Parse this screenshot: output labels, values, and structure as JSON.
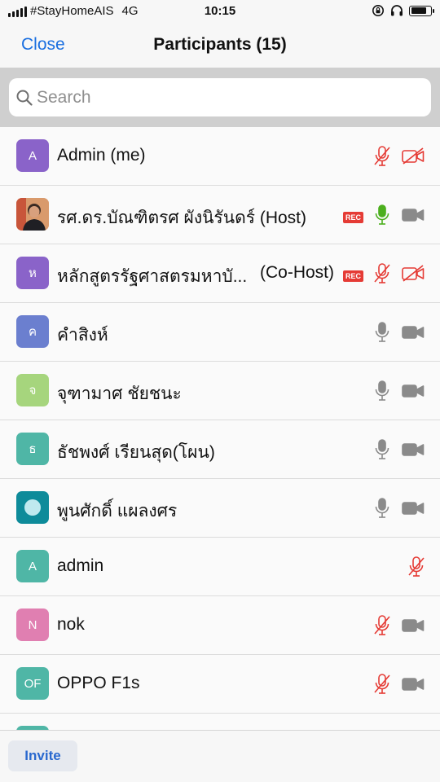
{
  "status_bar": {
    "carrier": "#StayHomeAIS",
    "network": "4G",
    "time": "10:15",
    "battery_level": 0.8
  },
  "nav": {
    "close_label": "Close",
    "title": "Participants (15)"
  },
  "search": {
    "placeholder": "Search"
  },
  "colors": {
    "accent": "#1a6fe0",
    "muted_red": "#e53b35",
    "unmuted_green": "#4caf1e",
    "icon_gray": "#8a8a8a"
  },
  "participants": [
    {
      "initial": "A",
      "avatar_color": "#8a63c9",
      "name": "Admin (me)",
      "role": "",
      "rec": false,
      "mic": "muted",
      "video": "off"
    },
    {
      "initial": "",
      "avatar_color": "photo",
      "name": "รศ.ดร.บัณฑิตรศ ผังนิรันดร์ (Host)",
      "role": "",
      "rec": true,
      "rec_label": "REC",
      "mic": "active",
      "video": "on"
    },
    {
      "initial": "ห",
      "avatar_color": "#8a63c9",
      "name": "หลักสูตรรัฐศาสตรมหาบั...",
      "role": "(Co-Host)",
      "rec": true,
      "rec_label": "REC",
      "mic": "muted",
      "video": "off"
    },
    {
      "initial": "ค",
      "avatar_color": "#6b7fcf",
      "name": "คำสิงห์",
      "role": "",
      "rec": false,
      "mic": "on",
      "video": "on"
    },
    {
      "initial": "จ",
      "avatar_color": "#a6d57d",
      "name": "จุฑามาศ  ชัยชนะ",
      "role": "",
      "rec": false,
      "mic": "on",
      "video": "on"
    },
    {
      "initial": "ธ",
      "avatar_color": "#4fb6a6",
      "name": "ธัชพงศ์ เรียนสุด(โผน)",
      "role": "",
      "rec": false,
      "mic": "on",
      "video": "on"
    },
    {
      "initial": "",
      "avatar_color": "teal-circle",
      "name": "พูนศักดิ์ แผลงศร",
      "role": "",
      "rec": false,
      "mic": "on",
      "video": "on"
    },
    {
      "initial": "A",
      "avatar_color": "#4fb6a6",
      "name": "admin",
      "role": "",
      "rec": false,
      "mic": "muted",
      "video": "none"
    },
    {
      "initial": "N",
      "avatar_color": "#e07fb1",
      "name": "nok",
      "role": "",
      "rec": false,
      "mic": "muted",
      "video": "on"
    },
    {
      "initial": "OF",
      "avatar_color": "#4fb6a6",
      "name": "OPPO F1s",
      "role": "",
      "rec": false,
      "mic": "muted",
      "video": "on"
    },
    {
      "initial": "",
      "avatar_color": "#4fb6a6",
      "name": "",
      "role": "",
      "rec": false,
      "mic": "none",
      "video": "none"
    }
  ],
  "footer": {
    "invite_label": "Invite"
  }
}
